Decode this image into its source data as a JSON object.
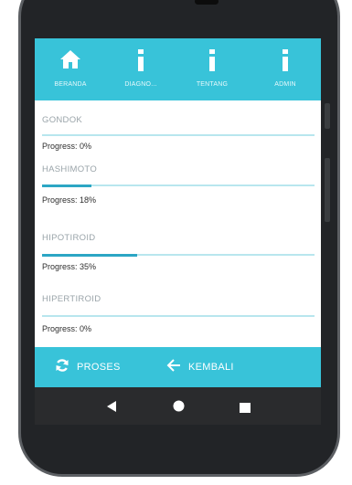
{
  "app_tabs": [
    {
      "label": "BERANDA",
      "icon": "home-icon"
    },
    {
      "label": "DIAGNO...",
      "icon": "info-icon"
    },
    {
      "label": "TENTANG",
      "icon": "info-icon"
    },
    {
      "label": "ADMIN",
      "icon": "info-icon"
    }
  ],
  "diseases": [
    {
      "name": "GONDOK",
      "progress_label": "Progress: 0%",
      "progress": 0
    },
    {
      "name": "HASHIMOTO",
      "progress_label": "Progress: 18%",
      "progress": 18
    },
    {
      "name": "HIPOTIROID",
      "progress_label": "Progress: 35%",
      "progress": 35
    },
    {
      "name": "HIPERTIROID",
      "progress_label": "Progress: 0%",
      "progress": 0
    }
  ],
  "actions": {
    "process_label": "PROSES",
    "back_label": "KEMBALI"
  },
  "colors": {
    "accent": "#38c3d9",
    "progress_fill": "#2ca6c4",
    "progress_track": "#b8e6ee",
    "phone_frame": "#222427"
  },
  "system_nav": [
    "back-icon",
    "home-circle-icon",
    "recents-icon"
  ]
}
